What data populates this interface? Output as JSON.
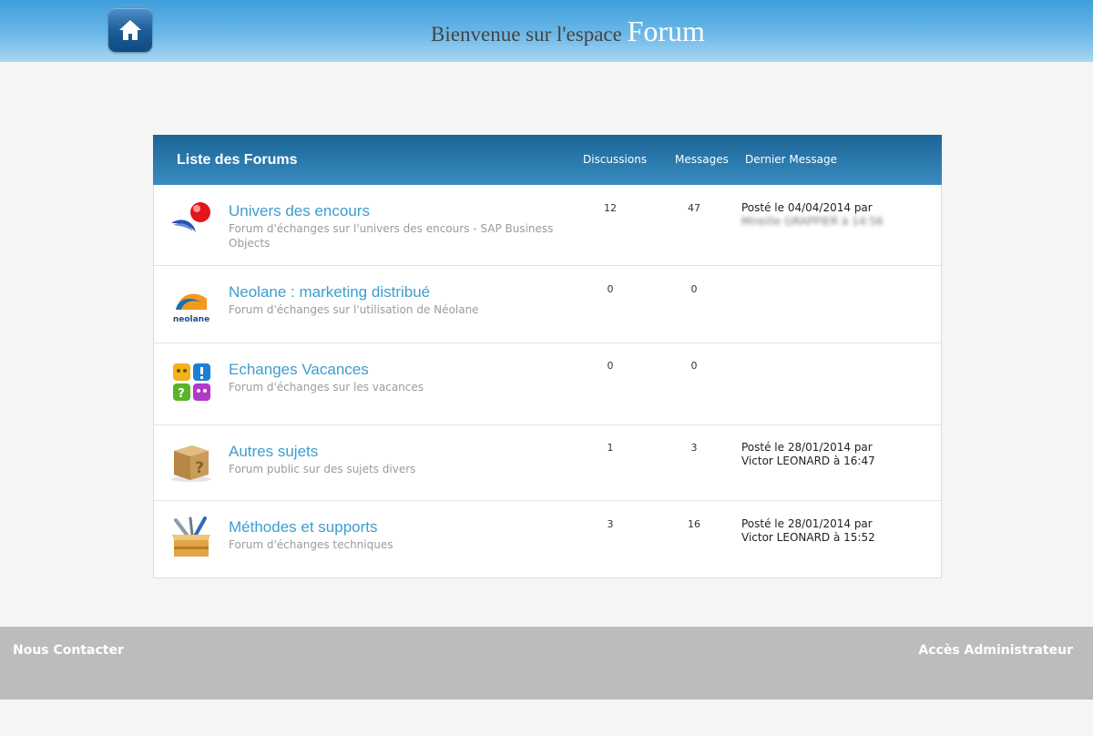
{
  "header": {
    "welcome_prefix": "Bienvenue sur l'espace",
    "welcome_highlight": "Forum",
    "home_icon": "home-icon",
    "colors": {
      "bar_top": "#3f9fdc",
      "bar_bottom": "#a9d6f2"
    }
  },
  "panel": {
    "title": "Liste des Forums",
    "col_discussions": "Discussions",
    "col_messages": "Messages",
    "col_last": "Dernier Message",
    "header_color": "#1c6496"
  },
  "forums": [
    {
      "name": "Univers des encours",
      "description": "Forum d'échanges sur l'univers des encours - SAP Business Objects",
      "discussions": "12",
      "messages": "47",
      "last_line1": "Posté le 04/04/2014 par",
      "last_line2": "Mireille GRAPPIER à 14:56",
      "icon": "sap-pin-logo-icon"
    },
    {
      "name": "Neolane : marketing distribué",
      "description": "Forum d'échanges sur l'utilisation de Néolane",
      "discussions": "0",
      "messages": "0",
      "last_line1": "",
      "last_line2": "",
      "icon": "neolane-logo-icon",
      "logo_text": "neolane"
    },
    {
      "name": "Echanges Vacances",
      "description": "Forum d'échanges sur les vacances",
      "discussions": "0",
      "messages": "0",
      "last_line1": "",
      "last_line2": "",
      "icon": "colored-blocks-icon"
    },
    {
      "name": "Autres sujets",
      "description": "Forum public sur des sujets divers",
      "discussions": "1",
      "messages": "3",
      "last_line1": "Posté le 28/01/2014 par",
      "last_line2": "Victor LEONARD à 16:47",
      "icon": "question-box-icon"
    },
    {
      "name": "Méthodes et supports",
      "description": "Forum d'échanges techniques",
      "discussions": "3",
      "messages": "16",
      "last_line1": "Posté le 28/01/2014 par",
      "last_line2": "Victor LEONARD à 15:52",
      "icon": "toolbox-icon"
    }
  ],
  "footer": {
    "contact": "Nous Contacter",
    "admin": "Accès Administrateur"
  }
}
